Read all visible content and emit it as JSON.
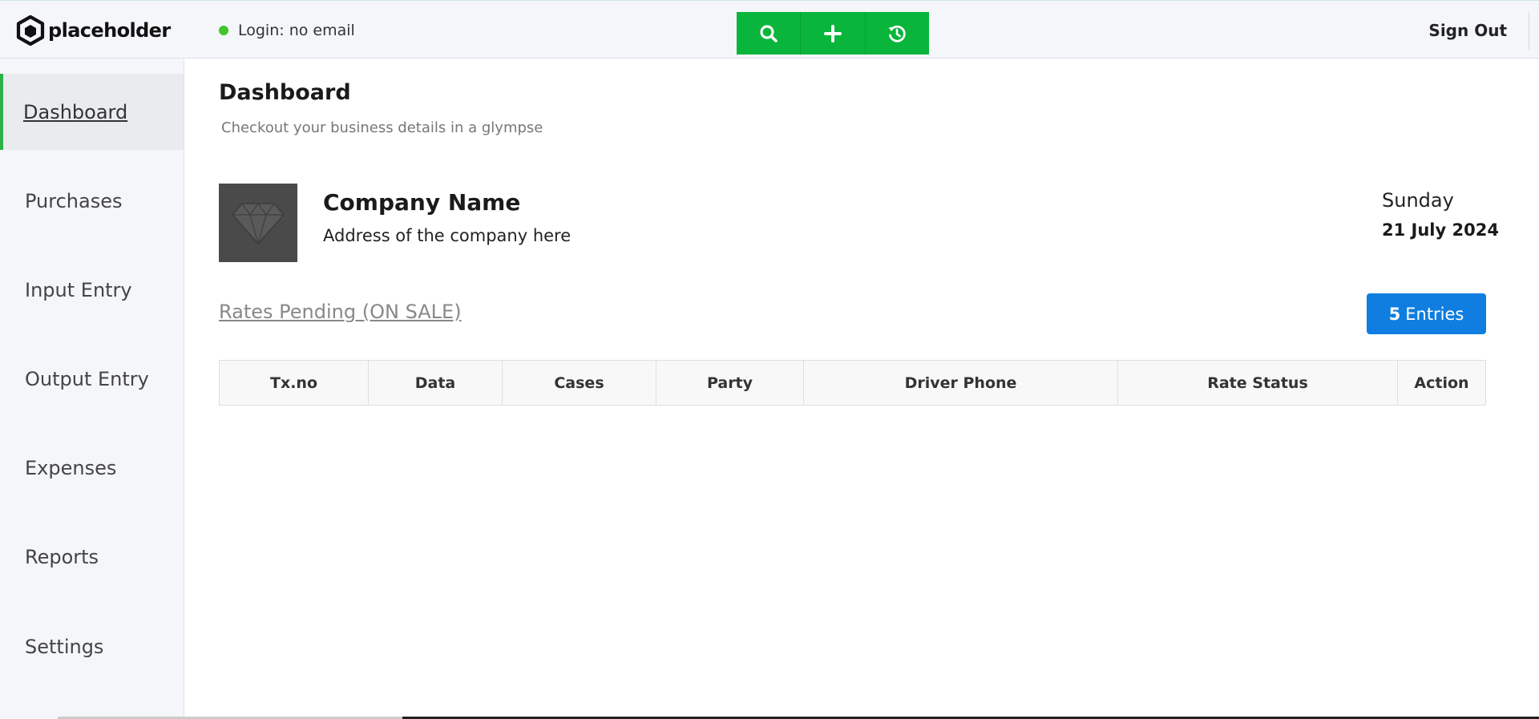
{
  "brand": {
    "name": "placeholder",
    "logo_icon": "hexagon-logo-icon"
  },
  "header": {
    "login_status": "Login: no email",
    "status_color": "#41c52b",
    "actions": [
      {
        "icon": "search-icon",
        "label": ""
      },
      {
        "icon": "plus-icon",
        "label": ""
      },
      {
        "icon": "history-icon",
        "label": ""
      }
    ],
    "accent": "#09b53b",
    "signout_label": "Sign Out"
  },
  "sidebar": {
    "items": [
      {
        "label": "Dashboard",
        "active": true
      },
      {
        "label": "Purchases"
      },
      {
        "label": "Input Entry"
      },
      {
        "label": "Output Entry"
      },
      {
        "label": "Expenses"
      },
      {
        "label": "Reports"
      },
      {
        "label": "Settings"
      }
    ]
  },
  "main": {
    "title": "Dashboard",
    "subtitle": "Checkout your business details in a glympse",
    "company": {
      "name": "Company Name",
      "address": "Address of the company here",
      "logo_icon": "diamond-icon"
    },
    "date": {
      "day": "Sunday",
      "full": "21 July 2024"
    },
    "section_link": "Rates Pending (ON SALE)",
    "entries": {
      "count": "5",
      "label": "Entries",
      "color": "#0f7ee0"
    },
    "table": {
      "columns": [
        "Tx.no",
        "Data",
        "Cases",
        "Party",
        "Driver Phone",
        "Rate Status",
        "Action"
      ],
      "rows": []
    }
  }
}
